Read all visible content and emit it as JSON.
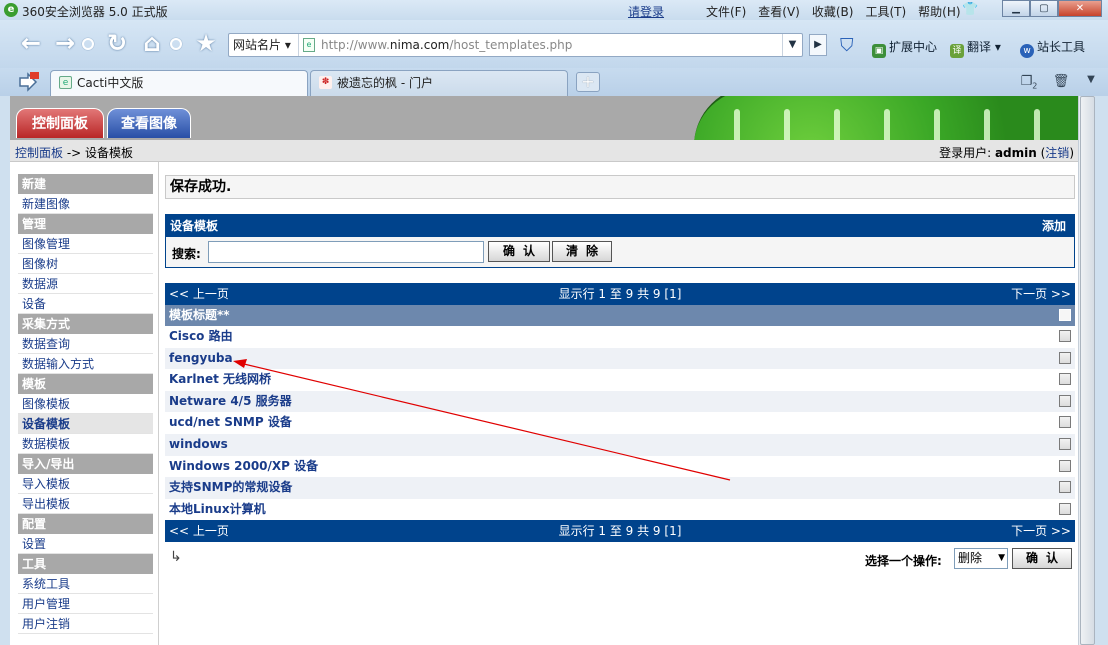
{
  "browser": {
    "title": "360安全浏览器 5.0 正式版",
    "login": "请登录",
    "menu": [
      "文件(F)",
      "查看(V)",
      "收藏(B)",
      "工具(T)",
      "帮助(H)"
    ],
    "site_card": "网站名片",
    "url_prefix": "http://www.",
    "url_domain": "nima.com",
    "url_path": "/host_templates.php",
    "toolbar": {
      "extensions": "扩展中心",
      "translate": "翻译",
      "webmaster": "站长工具"
    },
    "tabs": [
      {
        "label": "Cacti中文版",
        "active": true
      },
      {
        "label": "被遗忘的枫 - 门户",
        "active": false
      }
    ],
    "tab_count": "2"
  },
  "cacti": {
    "tabs": {
      "console": "控制面板",
      "graphs": "查看图像"
    },
    "breadcrumb": {
      "root": "控制面板",
      "sep": " -> ",
      "current": "设备模板"
    },
    "user": {
      "label": "登录用户: ",
      "name": "admin",
      "logout": "注销"
    }
  },
  "menu": [
    {
      "header": "新建",
      "items": [
        "新建图像"
      ]
    },
    {
      "header": "管理",
      "items": [
        "图像管理",
        "图像树",
        "数据源",
        "设备"
      ]
    },
    {
      "header": "采集方式",
      "items": [
        "数据查询",
        "数据输入方式"
      ]
    },
    {
      "header": "模板",
      "items": [
        "图像模板",
        "设备模板",
        "数据模板"
      ]
    },
    {
      "header": "导入/导出",
      "items": [
        "导入模板",
        "导出模板"
      ]
    },
    {
      "header": "配置",
      "items": [
        "设置"
      ]
    },
    {
      "header": "工具",
      "items": [
        "系统工具",
        "用户管理",
        "用户注销"
      ]
    }
  ],
  "selected_menu_item": "设备模板",
  "message": "保存成功.",
  "templates_box": {
    "title": "设备模板",
    "add": "添加",
    "search_label": "搜索:",
    "search_value": "",
    "go_button": "确认",
    "clear_button": "清除"
  },
  "list": {
    "prev": "<< 上一页",
    "next": "下一页 >>",
    "info": "显示行 1 至 9 共 9 [1]",
    "column": "模板标题**",
    "rows": [
      "Cisco 路由",
      "fengyuba",
      "Karlnet 无线网桥",
      "Netware 4/5 服务器",
      "ucd/net SNMP 设备",
      "windows",
      "Windows 2000/XP 设备",
      "支持SNMP的常规设备",
      "本地Linux计算机"
    ]
  },
  "action": {
    "label": "选择一个操作:",
    "selected": "删除",
    "confirm": "确认"
  },
  "colors": {
    "header_blue": "#00438c",
    "column_blue": "#6d88ad",
    "menu_gray": "#a8a8a8",
    "annotation_red": "#e00000"
  }
}
